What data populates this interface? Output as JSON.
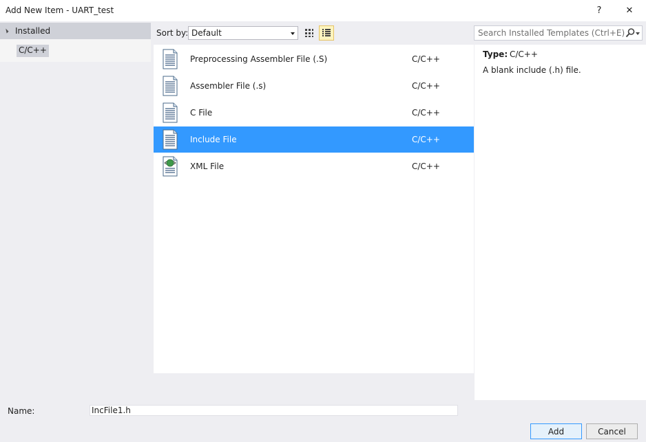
{
  "window": {
    "title": "Add New Item - UART_test",
    "help_label": "?",
    "close_label": "✕"
  },
  "tree": {
    "header": "Installed",
    "items": [
      {
        "label": "C/C++"
      }
    ]
  },
  "toolbar": {
    "sort_label": "Sort by:",
    "sort_value": "Default",
    "search_placeholder": "Search Installed Templates (Ctrl+E)"
  },
  "templates": [
    {
      "name": "Preprocessing Assembler File (.S)",
      "category": "C/C++",
      "icon": "document-icon",
      "selected": false
    },
    {
      "name": "Assembler File (.s)",
      "category": "C/C++",
      "icon": "document-icon",
      "selected": false
    },
    {
      "name": "C File",
      "category": "C/C++",
      "icon": "document-icon",
      "selected": false
    },
    {
      "name": "Include File",
      "category": "C/C++",
      "icon": "document-icon",
      "selected": true
    },
    {
      "name": "XML File",
      "category": "C/C++",
      "icon": "xml-file-icon",
      "selected": false
    }
  ],
  "details": {
    "type_key": "Type:",
    "type_value": "C/C++",
    "description": "A blank include (.h) file."
  },
  "footer": {
    "name_label": "Name:",
    "name_value": "IncFile1.h",
    "add_label": "Add",
    "cancel_label": "Cancel"
  },
  "colors": {
    "selection": "#3399ff",
    "background": "#eeeef2"
  }
}
